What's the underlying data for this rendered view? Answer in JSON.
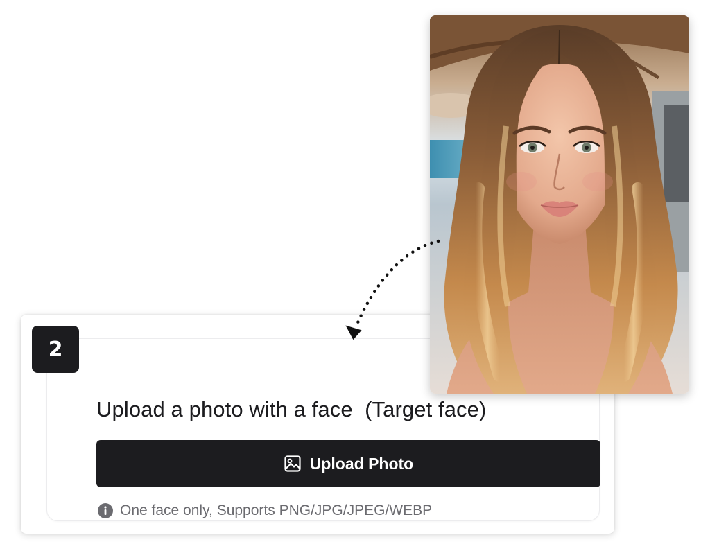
{
  "step": {
    "number": "2",
    "title": "Upload a photo with a face  (Target face)"
  },
  "upload_button": {
    "label": "Upload Photo",
    "icon": "image-icon"
  },
  "hint": {
    "icon": "info-icon",
    "text": "One face only, Supports PNG/JPG/JPEG/WEBP"
  },
  "photo": {
    "subject": "portrait of a woman with long wavy balayage hair"
  },
  "colors": {
    "button_bg": "#1c1c1f",
    "badge_bg": "#1c1c1f",
    "hint_text": "#6b6b70",
    "title_text": "#1c1c1f"
  }
}
